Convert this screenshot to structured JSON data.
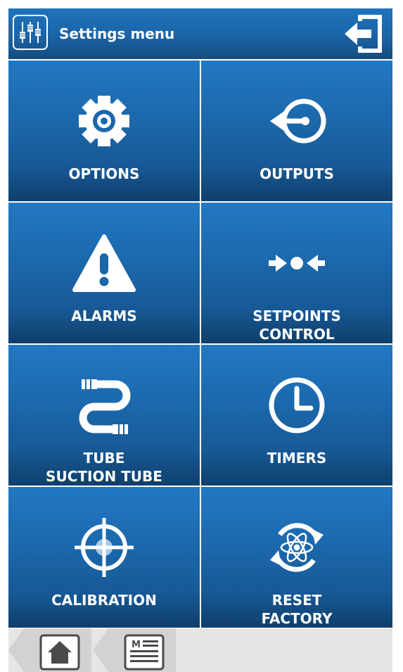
{
  "header": {
    "title": "Settings menu",
    "settings_icon": "sliders-icon",
    "exit_icon": "exit-icon"
  },
  "menu": {
    "tiles": [
      {
        "lines": [
          "OPTIONS"
        ],
        "icon": "gear-icon"
      },
      {
        "lines": [
          "OUTPUTS"
        ],
        "icon": "output-arrow-icon"
      },
      {
        "lines": [
          "ALARMS"
        ],
        "icon": "warning-icon"
      },
      {
        "lines": [
          "SETPOINTS",
          "CONTROL"
        ],
        "icon": "setpoint-icon"
      },
      {
        "lines": [
          "TUBE",
          "SUCTION TUBE"
        ],
        "icon": "tube-icon"
      },
      {
        "lines": [
          "TIMERS"
        ],
        "icon": "clock-icon"
      },
      {
        "lines": [
          "CALIBRATION"
        ],
        "icon": "crosshair-icon"
      },
      {
        "lines": [
          "RESET",
          "FACTORY"
        ],
        "icon": "reset-atom-icon"
      }
    ]
  },
  "footer": {
    "items": [
      {
        "icon": "home-icon"
      },
      {
        "icon": "menu-icon"
      }
    ]
  },
  "colors": {
    "tile_top": "#2278c3",
    "tile_bottom": "#0f3f6b",
    "text": "#ffffff",
    "footer_bg": "#e6e6e6",
    "tab_bg": "#d2d2d2"
  }
}
